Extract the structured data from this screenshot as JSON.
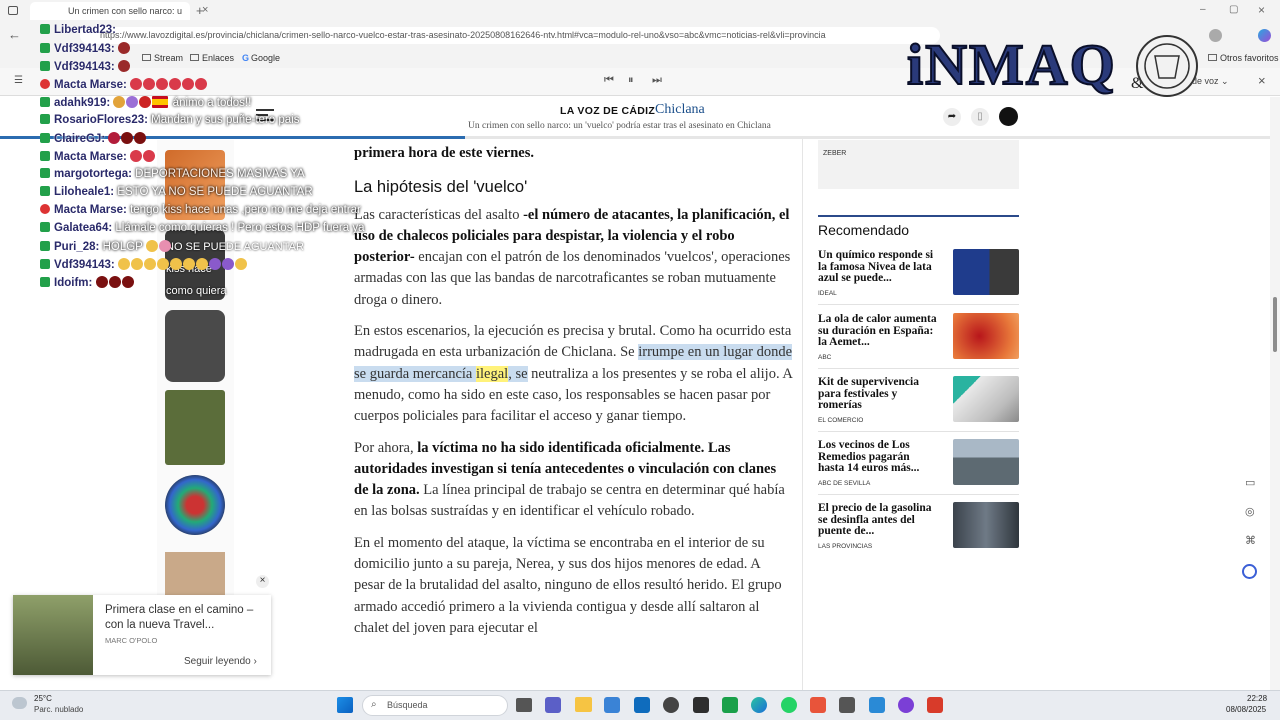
{
  "browser": {
    "tab_title": "Un crimen con sello narco: u",
    "url": "https://www.lavozdigital.es/provincia/chiclana/crimen-sello-narco-vuelco-estar-tras-asesinato-20250808162646-ntv.html#vca=modulo-rel-uno&vso=abc&vmc=noticias-rel&vli=provincia",
    "bookmarks": [
      "Stream",
      "Enlaces",
      "Google"
    ],
    "other_favorites": "Otros favoritos",
    "voice_label": "es de voz"
  },
  "site": {
    "brand": "LA VOZ DE CÁDIZ",
    "section": "Chiclana",
    "headline": "Un crimen con sello narco: un 'vuelco' podría estar tras el asesinato en Chiclana"
  },
  "article": {
    "p0": "primera hora de este viernes.",
    "h2": "La hipótesis del 'vuelco'",
    "p1a": "Las características del asalto ",
    "p1b": "-el número de atacantes, la planificación, el uso de chalecos policiales para despistar, la violencia y el robo posterior-",
    "p1c": " encajan con el patrón de los denominados 'vuelcos', operaciones armadas con las que las bandas de narcotraficantes se roban mutuamente droga o dinero.",
    "p2a": "En estos escenarios, la ejecución es precisa y brutal. Como ha ocurrido esta madrugada en esta urbanización de Chiclana. Se ",
    "p2hl": "irrumpe en un lugar donde se guarda mercancía ",
    "p2hly": "ilegal",
    "p2hl2": ", se",
    "p2b": " neutraliza a los presentes y se roba el alijo. A menudo, como ha sido en este caso, los responsables se hacen pasar por cuerpos policiales para facilitar el acceso y ganar tiempo.",
    "p3a": "Por ahora, ",
    "p3b": "la víctima no ha sido identificada oficialmente. Las autoridades investigan si tenía antecedentes o vinculación con clanes de la zona.",
    "p3c": " La línea principal de trabajo se centra en determinar qué había en las bolsas sustraídas y en identificar el vehículo robado.",
    "p4": "En el momento del ataque, la víctima se encontraba en el interior de su domicilio junto a su pareja, Nerea, y sus dos hijos menores de edad. A pesar de la brutalidad del asalto, ninguno de ellos resultó herido. El grupo armado accedió primero a la vivienda contigua y desde allí saltaron al chalet del joven para ejecutar el"
  },
  "sidebar": {
    "ad_label": "ZEBER",
    "recommended_title": "Recomendado",
    "items": [
      {
        "title": "Un químico responde si la famosa Nivea de lata azul se puede...",
        "source": "IDEAL",
        "color": "#1f3c8c"
      },
      {
        "title": "La ola de calor aumenta su duración en España: la Aemet...",
        "source": "ABC",
        "color": "#d4462a"
      },
      {
        "title": "Kit de supervivencia para festivales y romerías",
        "source": "EL COMERCIO",
        "color": "#c7c7c7"
      },
      {
        "title": "Los vecinos de Los Remedios pagarán hasta 14 euros más...",
        "source": "ABC DE SEVILLA",
        "color": "#7d8a95"
      },
      {
        "title": "El precio de la gasolina se desinfla antes del puente de...",
        "source": "LAS PROVINCIAS",
        "color": "#5a6470"
      }
    ]
  },
  "promo": {
    "title": "Primera clase en el camino – con la nueva Travel...",
    "brand": "MARC O'POLO",
    "cta": "Seguir leyendo ›"
  },
  "overlay_ad": {
    "line1": "NO SE PUEDE AGUANTAR",
    "line2": "kiss hace",
    "line3": "como quiera"
  },
  "chat": [
    {
      "name": "Libertad23:",
      "msg": "",
      "badge": "k"
    },
    {
      "name": "Vdf394143:",
      "msg": "",
      "badge": "k"
    },
    {
      "name": "Vdf394143:",
      "msg": "",
      "badge": "k"
    },
    {
      "name": "Macta Marse:",
      "msg": "",
      "badge": "r"
    },
    {
      "name": "adahk919:",
      "msg": "ánimo a todos!!",
      "badge": "k"
    },
    {
      "name": "RosarioFlores23:",
      "msg": "Mandan y sus puñe-tero pais",
      "badge": "k"
    },
    {
      "name": "ClaireGJ:",
      "msg": "",
      "badge": "k"
    },
    {
      "name": "Macta Marse:",
      "msg": "",
      "badge": "k"
    },
    {
      "name": "margotortega:",
      "msg": "DEPORTACIONES MASIVAS YA",
      "badge": "k"
    },
    {
      "name": "Liloheale1:",
      "msg": "ESTO YA NO SE PUEDE AGUANTAR",
      "badge": "k"
    },
    {
      "name": "Macta Marse:",
      "msg": "tengo kiss hace unas ,pero no me deja entrar",
      "badge": "r"
    },
    {
      "name": "Galatea64:",
      "msg": "Llámale como quieras ! Pero estos HDP fuera ya",
      "badge": "k"
    },
    {
      "name": "Puri_28:",
      "msg": "HOLGP",
      "badge": "k"
    },
    {
      "name": "Vdf394143:",
      "msg": "",
      "badge": "k"
    },
    {
      "name": "Idoifm:",
      "msg": "",
      "badge": "k"
    }
  ],
  "taskbar": {
    "weather_temp": "25°C",
    "weather_desc": "Parc. nublado",
    "search_placeholder": "Búsqueda",
    "time": "22:28",
    "date": "08/08/2025"
  }
}
